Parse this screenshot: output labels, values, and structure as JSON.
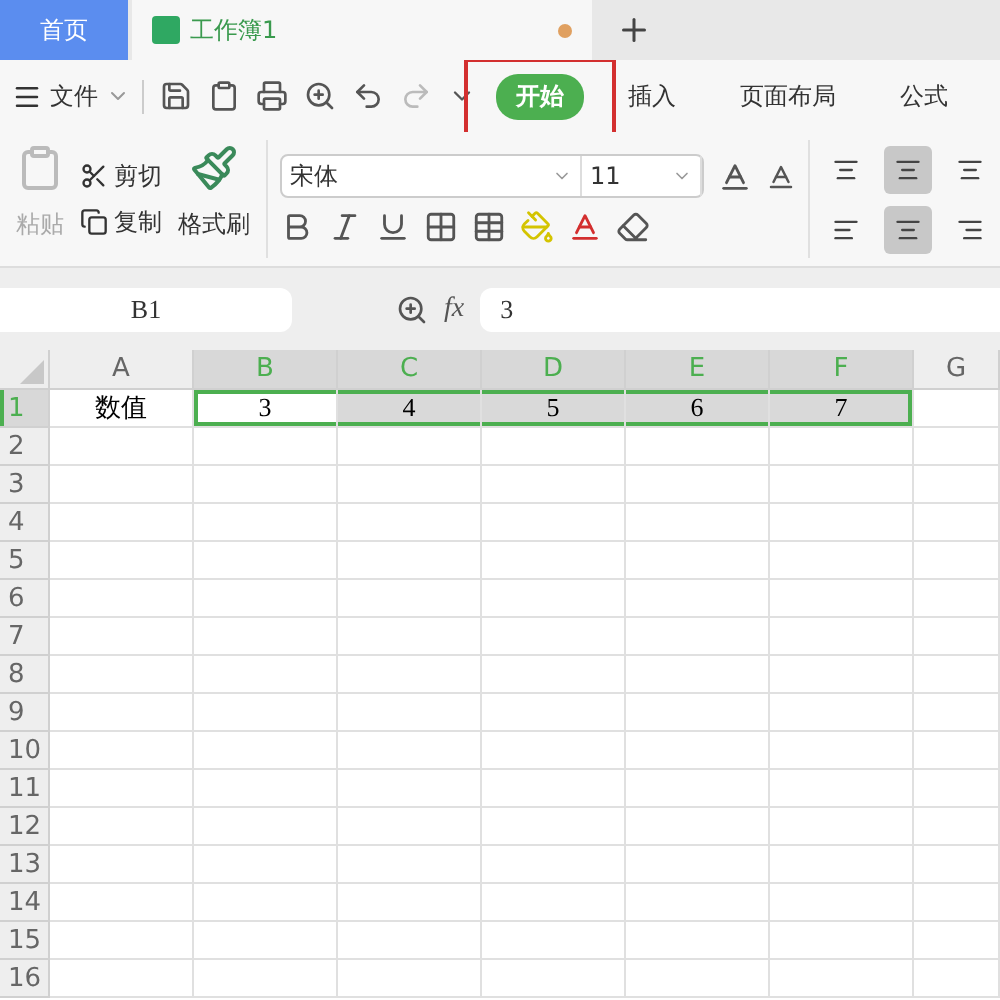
{
  "tabs": [
    {
      "label": "首页",
      "kind": "home"
    },
    {
      "label": "工作簿1",
      "kind": "doc",
      "unsaved": true
    }
  ],
  "menu": {
    "file": "文件",
    "ribbon_tabs": [
      {
        "label": "开始",
        "selected": true,
        "highlighted": true
      },
      {
        "label": "插入",
        "selected": false,
        "highlighted": false
      },
      {
        "label": "页面布局",
        "selected": false,
        "highlighted": false
      },
      {
        "label": "公式",
        "selected": false,
        "highlighted": false
      }
    ]
  },
  "clipboard": {
    "paste": {
      "label": "粘贴",
      "disabled": true
    },
    "cut": "剪切",
    "copy": "复制",
    "format_painter": "格式刷"
  },
  "font": {
    "name": "宋体",
    "size": "11"
  },
  "align": {
    "middle_selected": true,
    "center_selected": true
  },
  "formula_bar": {
    "name_box": "B1",
    "fx": "fx",
    "formula": "3"
  },
  "grid": {
    "columns": [
      {
        "label": "A",
        "selected": false
      },
      {
        "label": "B",
        "selected": true
      },
      {
        "label": "C",
        "selected": true
      },
      {
        "label": "D",
        "selected": true
      },
      {
        "label": "E",
        "selected": true
      },
      {
        "label": "F",
        "selected": true
      },
      {
        "label": "G",
        "selected": false
      }
    ],
    "rows": [
      {
        "label": "1",
        "selected": true,
        "cells": [
          {
            "value": "数值",
            "selected": false
          },
          {
            "value": "3",
            "selected": true,
            "active": true
          },
          {
            "value": "4",
            "selected": true,
            "active": false
          },
          {
            "value": "5",
            "selected": true,
            "active": false
          },
          {
            "value": "6",
            "selected": true,
            "active": false
          },
          {
            "value": "7",
            "selected": true,
            "active": false
          }
        ]
      },
      {
        "label": "2",
        "selected": false,
        "cells": []
      },
      {
        "label": "3",
        "selected": false,
        "cells": []
      },
      {
        "label": "4",
        "selected": false,
        "cells": []
      },
      {
        "label": "5",
        "selected": false,
        "cells": []
      },
      {
        "label": "6",
        "selected": false,
        "cells": []
      },
      {
        "label": "7",
        "selected": false,
        "cells": []
      },
      {
        "label": "8",
        "selected": false,
        "cells": []
      },
      {
        "label": "9",
        "selected": false,
        "cells": []
      },
      {
        "label": "10",
        "selected": false,
        "cells": []
      },
      {
        "label": "11",
        "selected": false,
        "cells": []
      },
      {
        "label": "12",
        "selected": false,
        "cells": []
      },
      {
        "label": "13",
        "selected": false,
        "cells": []
      },
      {
        "label": "14",
        "selected": false,
        "cells": []
      },
      {
        "label": "15",
        "selected": false,
        "cells": []
      },
      {
        "label": "16",
        "selected": false,
        "cells": []
      }
    ]
  }
}
